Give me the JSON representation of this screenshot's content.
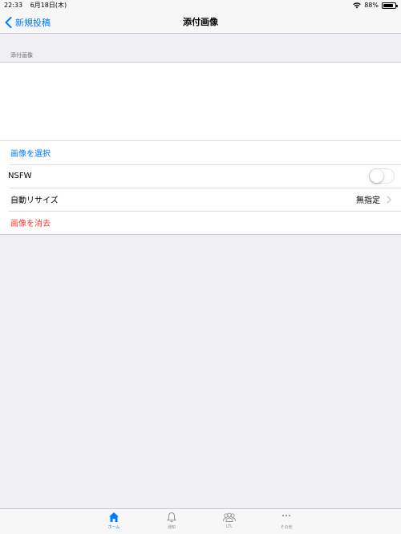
{
  "status_bar": {
    "time": "22:33",
    "date": "6月18日(木)",
    "battery": "88%"
  },
  "nav": {
    "back_label": "新規投稿",
    "title": "添付画像"
  },
  "section": {
    "header": "添付画像"
  },
  "rows": {
    "select_image": "画像を選択",
    "nsfw": {
      "label": "NSFW",
      "enabled": false
    },
    "auto_resize": {
      "label": "自動リサイズ",
      "value": "無指定"
    },
    "delete_image": "画像を消去"
  },
  "tabs": [
    {
      "label": "ホーム",
      "icon": "home-icon",
      "active": true
    },
    {
      "label": "通知",
      "icon": "bell-icon",
      "active": false
    },
    {
      "label": "LTL",
      "icon": "people-icon",
      "active": false
    },
    {
      "label": "その他",
      "icon": "more-icon",
      "active": false
    }
  ],
  "colors": {
    "accent": "#007aff",
    "destructive": "#ff3b30",
    "background": "#efeff4"
  }
}
